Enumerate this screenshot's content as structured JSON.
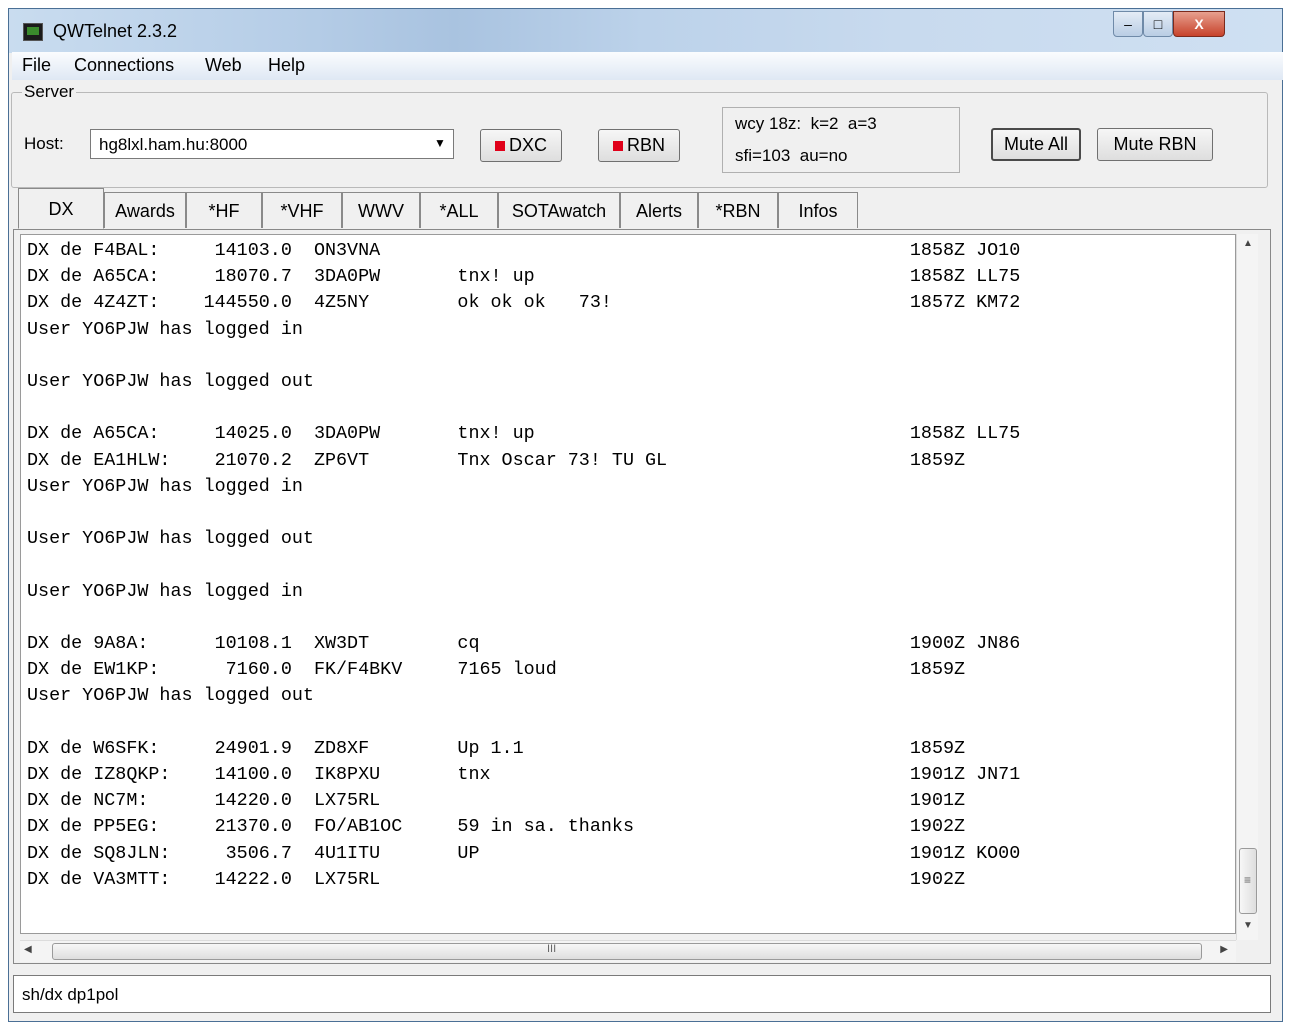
{
  "window": {
    "title": "QWTelnet 2.3.2",
    "minimize": "–",
    "maximize": "□",
    "close": "X"
  },
  "menu": [
    "File",
    "Connections",
    "Web",
    "Help"
  ],
  "server": {
    "legend": "Server",
    "host_label": "Host:",
    "host_value": "hg8lxl.ham.hu:8000",
    "dxc_label": "DXC",
    "rbn_label": "RBN",
    "indicator_color": "#e0001a",
    "info_line1": "wcy 18z:  k=2  a=3",
    "info_line2": "sfi=103  au=no",
    "mute_all": "Mute All",
    "mute_rbn": "Mute RBN"
  },
  "tabs": [
    "DX",
    "Awards",
    "*HF",
    "*VHF",
    "WWV",
    "*ALL",
    "SOTAwatch",
    "Alerts",
    "*RBN",
    "Infos"
  ],
  "active_tab": "DX",
  "console_lines": [
    "DX de F4BAL:     14103.0  ON3VNA                                                1858Z JO10",
    "DX de A65CA:     18070.7  3DA0PW       tnx! up                                  1858Z LL75",
    "DX de 4Z4ZT:    144550.0  4Z5NY        ok ok ok   73!                           1857Z KM72",
    "User YO6PJW has logged in",
    "",
    "User YO6PJW has logged out",
    "",
    "DX de A65CA:     14025.0  3DA0PW       tnx! up                                  1858Z LL75",
    "DX de EA1HLW:    21070.2  ZP6VT        Tnx Oscar 73! TU GL                      1859Z",
    "User YO6PJW has logged in",
    "",
    "User YO6PJW has logged out",
    "",
    "User YO6PJW has logged in",
    "",
    "DX de 9A8A:      10108.1  XW3DT        cq                                       1900Z JN86",
    "DX de EW1KP:      7160.0  FK/F4BKV     7165 loud                                1859Z",
    "User YO6PJW has logged out",
    "",
    "DX de W6SFK:     24901.9  ZD8XF        Up 1.1                                   1859Z",
    "DX de IZ8QKP:    14100.0  IK8PXU       tnx                                      1901Z JN71",
    "DX de NC7M:      14220.0  LX75RL                                                1901Z",
    "DX de PP5EG:     21370.0  FO/AB1OC     59 in sa. thanks                         1902Z",
    "DX de SQ8JLN:     3506.7  4U1ITU       UP                                       1901Z KO00",
    "DX de VA3MTT:    14222.0  LX75RL                                                1902Z"
  ],
  "command_input": "sh/dx dp1pol",
  "scroll": {
    "up": "▲",
    "down": "▼",
    "left": "◀",
    "right": "▶",
    "grip_v": "≡",
    "grip_h": "III"
  }
}
